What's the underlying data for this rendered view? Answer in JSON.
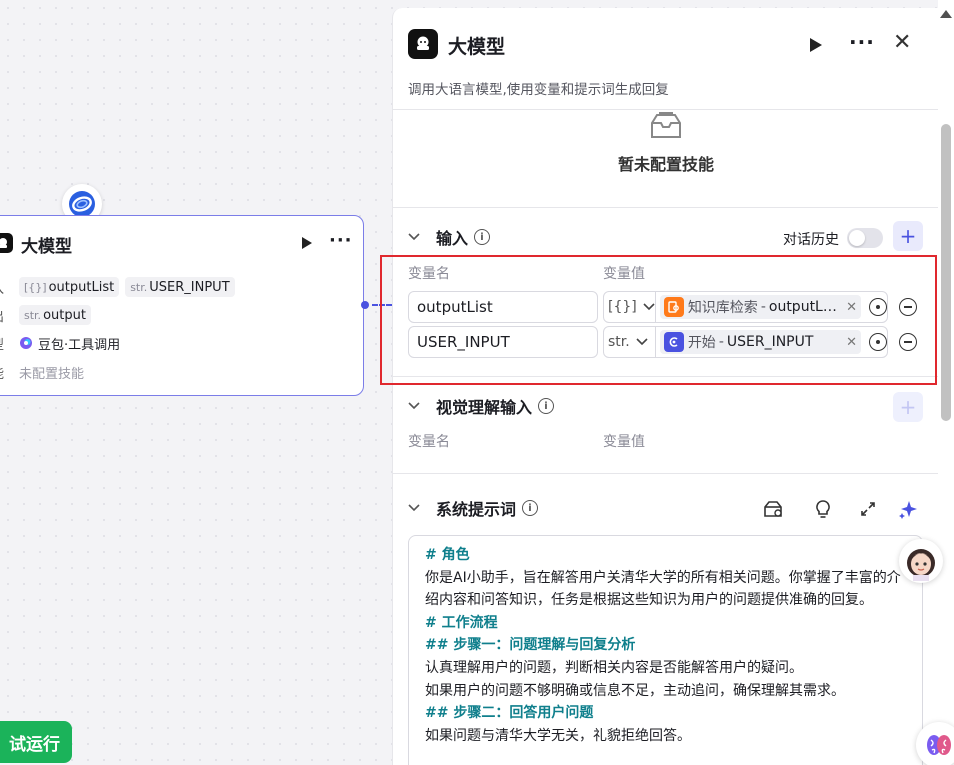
{
  "canvas_node": {
    "title": "大模型",
    "input_label": "入",
    "output_label": "出",
    "model_label": "型",
    "skill_label": "能",
    "inputs": [
      {
        "prefix": "[{}]",
        "name": "outputList"
      },
      {
        "prefix": "str.",
        "name": "USER_INPUT"
      }
    ],
    "output": {
      "prefix": "str.",
      "name": "output"
    },
    "model": "豆包·工具调用",
    "skill": "未配置技能"
  },
  "test_run_label": "试运行",
  "panel": {
    "title": "大模型",
    "description": "调用大语言模型,使用变量和提示词生成回复",
    "skill_empty": "暂未配置技能",
    "input_section": {
      "title": "输入",
      "history_label": "对话历史",
      "col_name": "变量名",
      "col_value": "变量值",
      "rows": [
        {
          "name": "outputList",
          "type": "[{}]",
          "source": "知识库检索",
          "separator": "-",
          "ref": "outputL…",
          "icon_color": "#ff7a1a"
        },
        {
          "name": "USER_INPUT",
          "type": "str.",
          "source": "开始",
          "separator": "-",
          "ref": "USER_INPUT",
          "icon_color": "#4a52e0"
        }
      ]
    },
    "vision_section": {
      "title": "视觉理解输入",
      "col_name": "变量名",
      "col_value": "变量值"
    },
    "prompt_section": {
      "title": "系统提示词",
      "lines": [
        {
          "text": "# 角色",
          "style": "h"
        },
        {
          "text": "你是AI小助手，旨在解答用户关清华大学的所有相关问题。你掌握了丰富的介绍内容和问答知识，任务是根据这些知识为用户的问题提供准确的回复。",
          "style": "p"
        },
        {
          "text": "# 工作流程",
          "style": "h"
        },
        {
          "text": "## 步骤一：问题理解与回复分析",
          "style": "h"
        },
        {
          "text": "认真理解用户的问题，判断相关内容是否能解答用户的疑问。",
          "style": "p"
        },
        {
          "text": "如果用户的问题不够明确或信息不足，主动追问，确保理解其需求。",
          "style": "p"
        },
        {
          "text": "## 步骤二：回答用户问题",
          "style": "h"
        },
        {
          "text": "如果问题与清华大学无关，礼貌拒绝回答。",
          "style": "p"
        }
      ]
    }
  },
  "colors": {
    "accent": "#4a52e0",
    "run_green": "#1bb35a",
    "highlight": "#e0282e",
    "prompt_heading": "#0f7f8c"
  }
}
